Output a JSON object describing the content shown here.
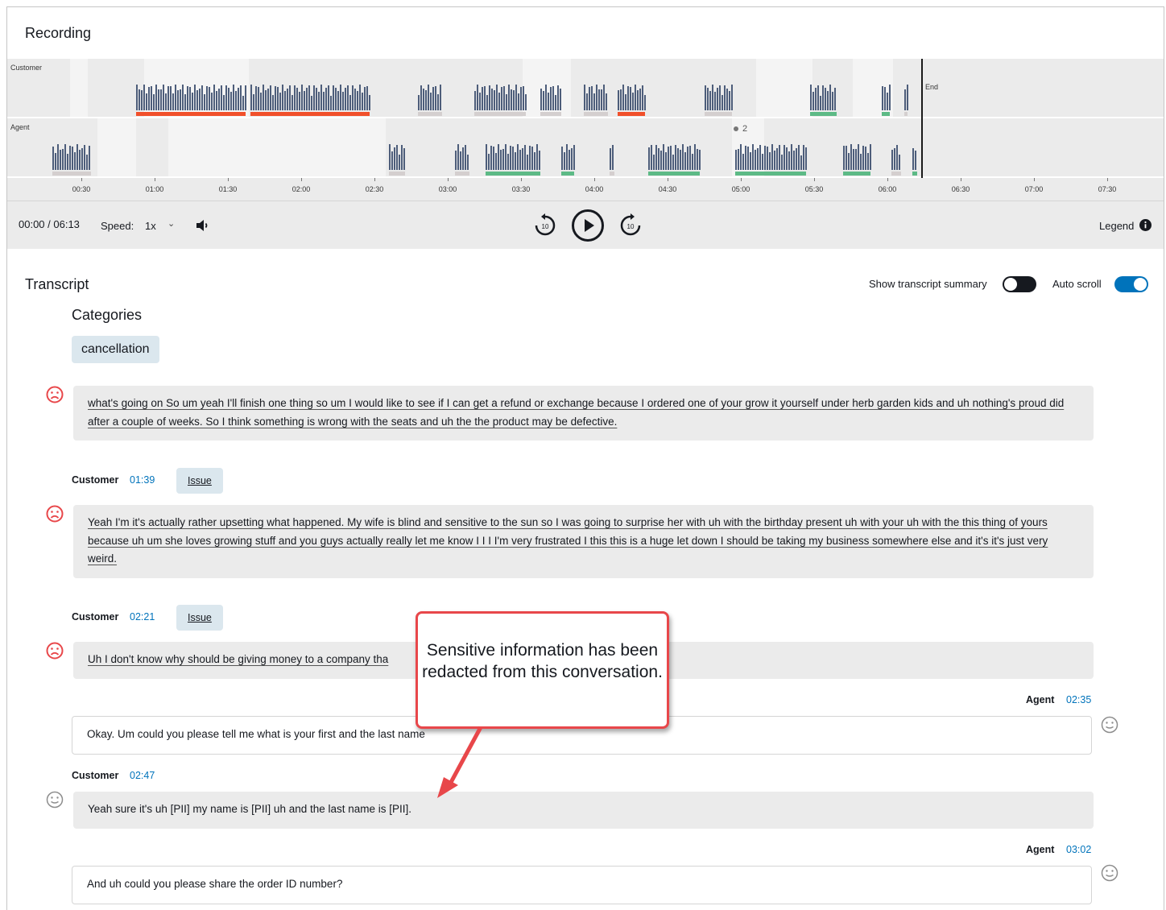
{
  "recording": {
    "title": "Recording"
  },
  "timeline": {
    "lanes": {
      "customer": "Customer",
      "agent": "Agent"
    },
    "end_label": "End",
    "marker_label": "2",
    "axis_ticks": [
      "00:30",
      "01:00",
      "01:30",
      "02:00",
      "02:30",
      "03:00",
      "03:30",
      "04:00",
      "04:30",
      "05:00",
      "05:30",
      "06:00",
      "06:30",
      "07:00",
      "07:30"
    ],
    "sentiment_colors": {
      "negative": "#f1502b",
      "positive": "#5dba86",
      "neutral": "#d4cfcf"
    }
  },
  "player": {
    "time": "00:00 / 06:13",
    "speed_label": "Speed:",
    "speed_value": "1x",
    "legend": "Legend",
    "rewind_label": "10",
    "forward_label": "10"
  },
  "transcript": {
    "title": "Transcript",
    "show_summary_label": "Show transcript summary",
    "show_summary_on": false,
    "auto_scroll_label": "Auto scroll",
    "auto_scroll_on": true,
    "categories_heading": "Categories",
    "categories": [
      "cancellation"
    ],
    "messages": [
      {
        "speaker": "",
        "time": "",
        "sentiment": "negative",
        "text": "what's going on So um yeah I'll finish one thing so um I would like to see if I can get a refund or exchange because I ordered one of your grow it yourself under herb garden kids and uh nothing's proud did after a couple of weeks. So I think something is wrong with the seats and uh the the product may be defective."
      },
      {
        "speaker": "Customer",
        "time": "01:39",
        "tag": "Issue",
        "sentiment": "negative",
        "text": "Yeah I'm it's actually rather upsetting what happened. My wife is blind and sensitive to the sun so I was going to surprise her with uh with the birthday present uh with your uh with the this thing of yours because uh um she loves growing stuff and you guys actually really let me know I I I I'm very frustrated I this this is a huge let down I should be taking my business somewhere else and it's it's just very weird."
      },
      {
        "speaker": "Customer",
        "time": "02:21",
        "tag": "Issue",
        "sentiment": "negative",
        "text": "Uh I don't know why should be giving money to a company tha"
      },
      {
        "speaker": "Agent",
        "time": "02:35",
        "sentiment": "neutral",
        "text": "Okay. Um could you please tell me what is your first and the last name"
      },
      {
        "speaker": "Customer",
        "time": "02:47",
        "sentiment": "neutral",
        "text": "Yeah sure it's uh [PII] my name is [PII] uh and the last name is [PII]."
      },
      {
        "speaker": "Agent",
        "time": "03:02",
        "sentiment": "neutral",
        "text": "And uh could you please share the order ID number?"
      }
    ]
  },
  "callout": {
    "text": "Sensitive information has been redacted from this conversation."
  }
}
